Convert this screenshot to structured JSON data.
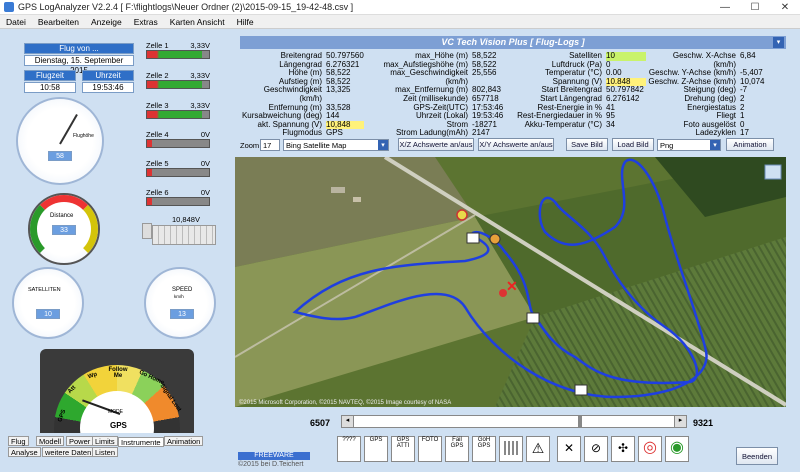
{
  "window": {
    "title": "GPS LogAnalyzer V2.2.4    [ F:\\flightlogs\\Neuer Ordner (2)\\2015-09-15_19-42-48.csv ]",
    "min": "—",
    "max": "☐",
    "close": "✕"
  },
  "menu": [
    "Datei",
    "Bearbeiten",
    "Anzeige",
    "Extras",
    "Karten Ansicht",
    "Hilfe"
  ],
  "flight": {
    "header": "Flug von ...",
    "date": "Dienstag, 15. September 2015",
    "flugzeit_label": "Flugzeit",
    "uhrzeit_label": "Uhrzeit",
    "flugzeit": "10:58",
    "uhrzeit": "19:53:46"
  },
  "cells": [
    {
      "label": "Zelle 1",
      "value": "3,33V",
      "fill": 0.95
    },
    {
      "label": "Zelle 2",
      "value": "3,33V",
      "fill": 0.95
    },
    {
      "label": "Zelle 3",
      "value": "3,33V",
      "fill": 0.95
    },
    {
      "label": "Zelle 4",
      "value": "0V",
      "fill": 0.05
    },
    {
      "label": "Zelle 5",
      "value": "0V",
      "fill": 0.05
    },
    {
      "label": "Zelle 6",
      "value": "0V",
      "fill": 0.05
    }
  ],
  "battery_voltage": "10,848V",
  "gauges": {
    "flughoehe": {
      "title": "Flughöhe",
      "value": "58"
    },
    "distance": {
      "title": "Distance",
      "value": "33"
    },
    "satelliten": {
      "title": "SATELLITEN",
      "value": "10"
    },
    "speed": {
      "title": "SPEED",
      "unit": "km/h",
      "value": "13"
    },
    "mode": {
      "label": "MODE",
      "sub": "GPS",
      "segments": [
        "GPS",
        "Att",
        "Wp",
        "Follow Me",
        "Go Home",
        "Signal Lost"
      ]
    }
  },
  "left_tabs": [
    "Flug",
    "Modell",
    "Power",
    "Limits",
    "Instrumente",
    "Animation",
    "Analyse",
    "weitere Daten",
    "Listen"
  ],
  "right_header": "VC Tech Vision Plus [ Flug-Logs ]",
  "data_cols": [
    [
      [
        "Breitengrad",
        "50.797560"
      ],
      [
        "Längengrad",
        "6.276321"
      ],
      [
        "Höhe (m)",
        "58,522"
      ],
      [
        "Aufstieg (m)",
        "58,522"
      ],
      [
        "Geschwindigkeit (km/h)",
        "13,325"
      ],
      [
        "Entfernung (m)",
        "33,528"
      ],
      [
        "Kursabweichung (deg)",
        "144"
      ],
      [
        "akt. Spannung (V)",
        "10,848"
      ],
      [
        "Flugmodus",
        "GPS"
      ]
    ],
    [
      [
        "max_Höhe (m)",
        "58,522"
      ],
      [
        "max_Aufstiegshöhe (m)",
        "58,522"
      ],
      [
        "max_Geschwindigkeit (km/h)",
        "25,556"
      ],
      [
        "max_Entfernung (m)",
        "802,843"
      ],
      [
        "Zeit (millisekunde)",
        "657718"
      ],
      [
        "GPS-Zeit(UTC)",
        "17:53:46"
      ],
      [
        "Uhrzeit (Lokal)",
        "19:53:46"
      ],
      [
        "Strom",
        "-18271"
      ],
      [
        "Strom Ladung(mAh)",
        "2147"
      ]
    ],
    [
      [
        "Satelliten",
        "10"
      ],
      [
        "Luftdruck (Pa)",
        "0"
      ],
      [
        "Temperatur (°C)",
        "0.00"
      ],
      [
        "Spannung (V)",
        "10.848"
      ],
      [
        "Start Breitengrad",
        "50.797842"
      ],
      [
        "Start Längengrad",
        "6.276142"
      ],
      [
        "Rest-Energie in %",
        "41"
      ],
      [
        "Rest-Energiedauer in %",
        "95"
      ],
      [
        "Akku-Temperatur (°C)",
        "34"
      ]
    ],
    [
      [
        "Geschw. X-Achse (km/h)",
        "6,84"
      ],
      [
        "Geschw. Y-Achse (km/h)",
        "-5,407"
      ],
      [
        "Geschw. Z-Achse (km/h)",
        "10,074"
      ],
      [
        "Steigung (deg)",
        "-7"
      ],
      [
        "Drehung (deg)",
        "2"
      ],
      [
        "Energiestatus",
        "2"
      ],
      [
        "Fliegt",
        "1"
      ],
      [
        "Foto ausgelöst",
        "0"
      ],
      [
        "Ladezyklen",
        "17"
      ]
    ]
  ],
  "controls": {
    "zoom_label": "Zoom",
    "zoom_value": "17",
    "map_type": "Bing Satellite Map",
    "xz": "X/Z Achswerte an/aus",
    "xy": "X/Y Achswerte an/aus",
    "save": "Save Bild",
    "load": "Load Bild",
    "format": "Png",
    "animation": "Animation"
  },
  "map_credit": "©2015 Microsoft Corporation, ©2015 NAVTEQ, ©2015 Image courtesy of NASA",
  "slider": {
    "min": "6507",
    "max": "9321",
    "position": 0.47
  },
  "freeware": "FREEWARE",
  "copyright": "©2015  bei D.Teichert",
  "tool_icons": [
    "????",
    "GPS",
    "GPS ATTI",
    "FOTO",
    "Fail GPS",
    "GoH GPS",
    "",
    "warning",
    "fish",
    "",
    "",
    "target",
    "target2"
  ],
  "beenden": "Beenden",
  "colors": {
    "accent": "#2f6fc7",
    "track": "#1f3fe0",
    "header": "#7d9fd4"
  }
}
